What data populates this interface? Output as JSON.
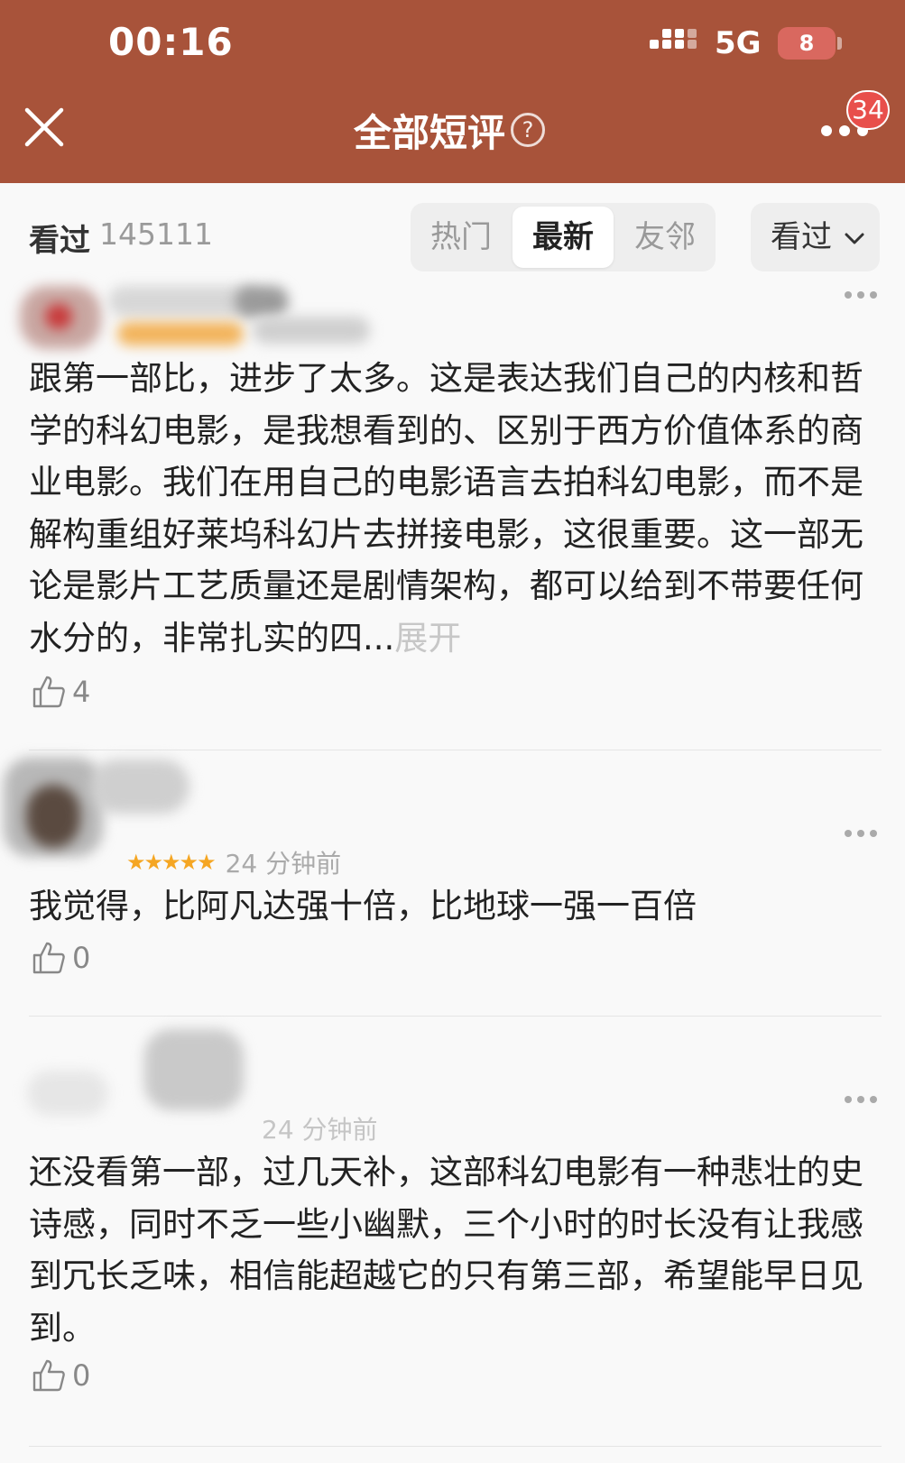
{
  "status_bar": {
    "time": "00:16",
    "network": "5G",
    "battery": "8"
  },
  "header": {
    "title": "全部短评",
    "help_glyph": "?",
    "badge_count": "34"
  },
  "filter_bar": {
    "seen_label": "看过",
    "seen_count": "145111",
    "tabs": [
      {
        "label": "热门",
        "active": false
      },
      {
        "label": "最新",
        "active": true
      },
      {
        "label": "友邻",
        "active": false
      }
    ],
    "dropdown_label": "看过"
  },
  "reviews": [
    {
      "time": "",
      "stars": "",
      "text": "跟第一部比，进步了太多。这是表达我们自己的内核和哲学的科幻电影，是我想看到的、区别于西方价值体系的商业电影。我们在用自己的电影语言去拍科幻电影，而不是解构重组好莱坞科幻片去拼接电影，这很重要。这一部无论是影片工艺质量还是剧情架构，都可以给到不带要任何水分的，非常扎实的四...",
      "expand_label": "展开",
      "likes": "4"
    },
    {
      "time": "24 分钟前",
      "stars": "★★★★★",
      "text": "我觉得，比阿凡达强十倍，比地球一强一百倍",
      "likes": "0"
    },
    {
      "time": "24 分钟前",
      "stars": "",
      "text": "还没看第一部，过几天补，这部科幻电影有一种悲壮的史诗感，同时不乏一些小幽默，三个小时的时长没有让我感到冗长乏味，相信能超越它的只有第三部，希望能早日见到。",
      "likes": "0"
    }
  ],
  "colors": {
    "header_bg": "#a8533a",
    "badge_red": "#e84f4b",
    "star": "#f5a623"
  }
}
